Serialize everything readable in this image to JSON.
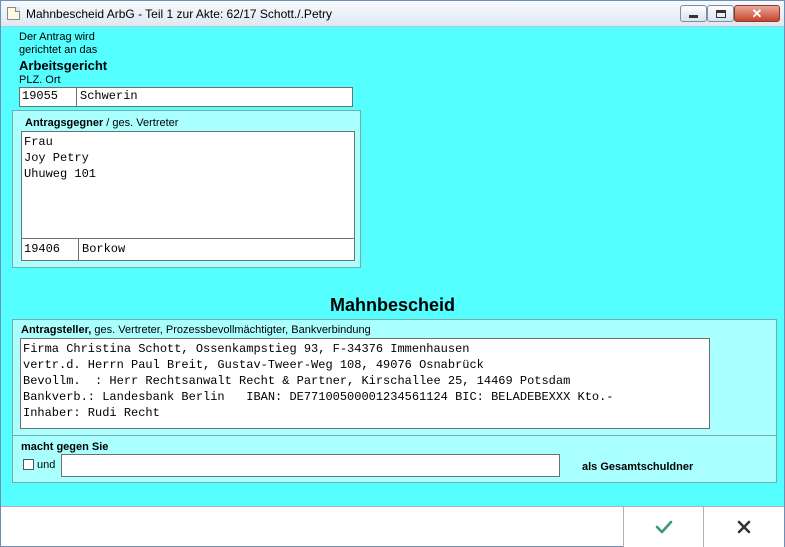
{
  "window": {
    "title": "Mahnbescheid ArbG - Teil 1   zur Akte: 62/17   Schott./.Petry"
  },
  "court": {
    "intro_line1": "Der Antrag wird",
    "intro_line2": "gerichtet an das",
    "name": "Arbeitsgericht",
    "plz_ort_label": "PLZ. Ort",
    "plz": "19055",
    "ort": "Schwerin"
  },
  "respondent": {
    "label_bold": "Antragsgegner",
    "label_rest": " / ges. Vertreter",
    "lines": [
      "Frau",
      "Joy Petry",
      "Uhuweg 101"
    ],
    "plz": "19406",
    "ort": "Borkow"
  },
  "heading": "Mahnbescheid",
  "applicant": {
    "label_bold": "Antragsteller,",
    "label_rest": " ges. Vertreter, Prozessbevollmächtigter, Bankverbindung",
    "lines": [
      "Firma Christina Schott, Ossenkampstieg 93, F-34376 Immenhausen",
      "vertr.d. Herrn Paul Breit, Gustav-Tweer-Weg 108, 49076 Osnabrück",
      "Bevollm.  : Herr Rechtsanwalt Recht & Partner, Kirschallee 25, 14469 Potsdam",
      "Bankverb.: Landesbank Berlin   IBAN: DE77100500001234561124 BIC: BELADEBEXXX Kto.-",
      "Inhaber: Rudi Recht"
    ]
  },
  "claim": {
    "label": "macht gegen Sie",
    "und_label": "und",
    "und_checked": false,
    "co_debtor_value": "",
    "suffix": "als Gesamtschuldner"
  },
  "buttons": {
    "ok_icon": "check-icon",
    "cancel_icon": "close-icon",
    "ok_color": "#3a9a6e",
    "cancel_color": "#333333"
  },
  "colors": {
    "background": "#55ffff",
    "panel": "#aaffff"
  }
}
